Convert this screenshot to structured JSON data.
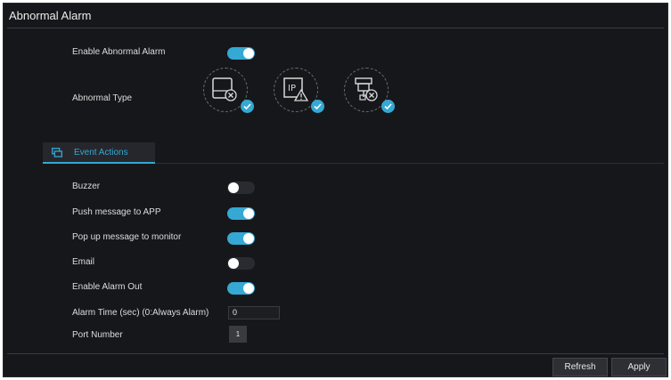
{
  "window": {
    "title": "Abnormal Alarm"
  },
  "settings": {
    "enable_label": "Enable Abnormal Alarm",
    "enable_state": true,
    "abnormal_type_label": "Abnormal Type",
    "abnormal_types": [
      {
        "icon": "hdd-error-icon",
        "checked": true
      },
      {
        "icon": "ip-conflict-icon",
        "checked": true
      },
      {
        "icon": "network-disconnect-icon",
        "checked": true
      }
    ]
  },
  "tab": {
    "label": "Event Actions",
    "icon": "event-actions-icon"
  },
  "actions": {
    "buzzer": {
      "label": "Buzzer",
      "on": false
    },
    "push_app": {
      "label": "Push message to APP",
      "on": true
    },
    "popup_monitor": {
      "label": "Pop up message to monitor",
      "on": true
    },
    "email": {
      "label": "Email",
      "on": false
    },
    "alarm_out": {
      "label": "Enable Alarm Out",
      "on": true
    },
    "alarm_time": {
      "label": "Alarm Time (sec) (0:Always Alarm)",
      "value": "0"
    },
    "port_number": {
      "label": "Port Number",
      "value": "1"
    }
  },
  "buttons": {
    "refresh": "Refresh",
    "apply": "Apply"
  },
  "colors": {
    "accent": "#35a8d4",
    "background": "#16171b"
  }
}
